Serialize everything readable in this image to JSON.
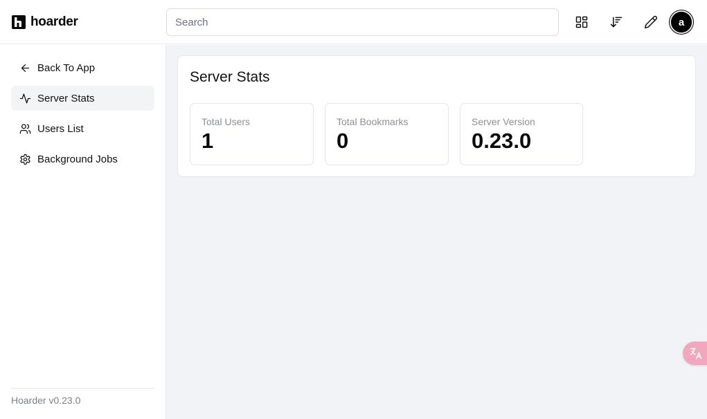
{
  "brand": {
    "name": "hoarder"
  },
  "header": {
    "search_placeholder": "Search",
    "avatar_initial": "a"
  },
  "sidebar": {
    "items": [
      {
        "label": "Back To App",
        "icon": "arrow-left-icon",
        "active": false
      },
      {
        "label": "Server Stats",
        "icon": "activity-icon",
        "active": true
      },
      {
        "label": "Users List",
        "icon": "users-icon",
        "active": false
      },
      {
        "label": "Background Jobs",
        "icon": "gear-icon",
        "active": false
      }
    ],
    "version": "Hoarder v0.23.0"
  },
  "main": {
    "title": "Server Stats",
    "stats": [
      {
        "label": "Total Users",
        "value": "1"
      },
      {
        "label": "Total Bookmarks",
        "value": "0"
      },
      {
        "label": "Server Version",
        "value": "0.23.0"
      }
    ]
  },
  "colors": {
    "main_bg": "#f1f3f7",
    "active_nav_bg": "#f3f4f6",
    "translate_widget": "#f2a7bf"
  }
}
